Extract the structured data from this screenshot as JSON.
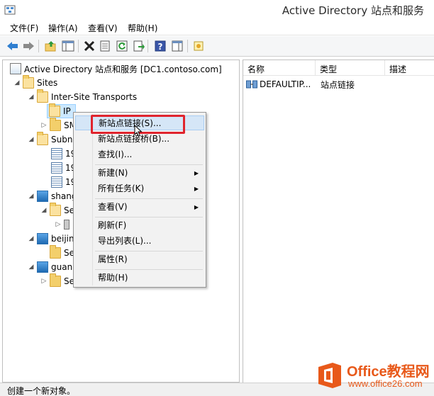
{
  "window": {
    "title": "Active Directory 站点和服务"
  },
  "menu": {
    "file": "文件(F)",
    "action": "操作(A)",
    "view": "查看(V)",
    "help": "帮助(H)"
  },
  "toolbar": {
    "icons": [
      "back-icon",
      "forward-icon",
      "up-folder-icon",
      "show-hide-console-tree-icon",
      "delete-icon",
      "properties-icon",
      "refresh-icon",
      "export-list-icon",
      "help-icon",
      "action-pane-icon",
      "new-object-icon"
    ]
  },
  "tree": {
    "root": "Active Directory 站点和服务 [DC1.contoso.com]",
    "sites": "Sites",
    "inter_site_transports": "Inter-Site Transports",
    "ip": "IP",
    "smtp": "SM",
    "subnets": "Subne",
    "subnet1": "19",
    "subnet2": "19",
    "subnet3": "19",
    "site_shanghai": "shang",
    "site_shanghai_servers": "Se",
    "site_beijing": "beijin",
    "site_beijing_servers": "Se",
    "site_guangzhou": "guan",
    "site_guangzhou_servers": "Se"
  },
  "list": {
    "headers": {
      "name": "名称",
      "type": "类型",
      "description": "描述"
    },
    "rows": [
      {
        "name": "DEFAULTIP...",
        "type": "站点链接",
        "description": ""
      }
    ]
  },
  "context_menu": {
    "new_site_link": "新站点链接(S)...",
    "new_site_link_bridge": "新站点链接桥(B)...",
    "find": "查找(I)...",
    "new": "新建(N)",
    "all_tasks": "所有任务(K)",
    "view": "查看(V)",
    "refresh": "刷新(F)",
    "export_list": "导出列表(L)...",
    "properties": "属性(R)",
    "help": "帮助(H)"
  },
  "status": {
    "text": "创建一个新对象。"
  },
  "watermark": {
    "title": "Office教程网",
    "url": "www.office26.com"
  },
  "colors": {
    "highlight_border": "#e0242d",
    "selection": "#cce8ff",
    "watermark": "#e8591a"
  }
}
